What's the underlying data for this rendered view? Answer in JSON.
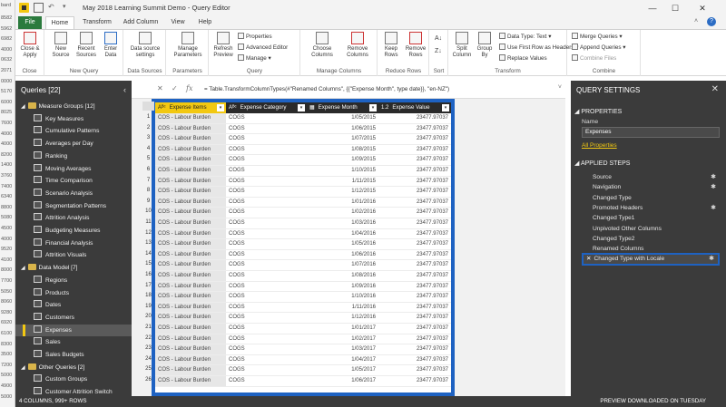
{
  "background_excel": {
    "fragment_text": "bard",
    "row_values": [
      "8582",
      "5962",
      "6982",
      "4000",
      "0632",
      "2071",
      "0000",
      "5170",
      "6000",
      "8025",
      "7600",
      "4000",
      "4000",
      "8200",
      "1400",
      "3760",
      "7400",
      "6340",
      "8800",
      "5080",
      "4500",
      "4000",
      "9520",
      "4100",
      "8000",
      "7700",
      "5050",
      "8060",
      "9280",
      "6920",
      "6100",
      "8300",
      "3500",
      "7200",
      "5000",
      "4900",
      "5000"
    ]
  },
  "window": {
    "title": "May 2018 Learning Summit Demo - Query Editor",
    "min_icon": "minimize-icon",
    "max_icon": "maximize-icon",
    "close_icon": "close-icon"
  },
  "ribbon_tabs": [
    "File",
    "Home",
    "Transform",
    "Add Column",
    "View",
    "Help"
  ],
  "ribbon": {
    "close": {
      "btn1": "Close &\nApply",
      "group": "Close"
    },
    "new_query": {
      "btn1": "New\nSource",
      "btn2": "Recent\nSources",
      "btn3": "Enter\nData",
      "group": "New Query"
    },
    "data_sources": {
      "btn1": "Data source\nsettings",
      "group": "Data Sources"
    },
    "parameters": {
      "btn1": "Manage\nParameters",
      "group": "Parameters"
    },
    "query": {
      "btn1": "Refresh\nPreview",
      "small1": "Properties",
      "small2": "Advanced Editor",
      "small3": "Manage",
      "group": "Query"
    },
    "manage_columns": {
      "btn1": "Choose\nColumns",
      "btn2": "Remove\nColumns",
      "group": "Manage Columns"
    },
    "reduce_rows": {
      "btn1": "Keep\nRows",
      "btn2": "Remove\nRows",
      "group": "Reduce Rows"
    },
    "sort": {
      "group": "Sort"
    },
    "transform": {
      "btn1": "Split\nColumn",
      "btn2": "Group\nBy",
      "small1": "Data Type: Text",
      "small2": "Use First Row as Headers",
      "small3": "Replace Values",
      "group": "Transform"
    },
    "combine": {
      "small1": "Merge Queries",
      "small2": "Append Queries",
      "small3": "Combine Files",
      "group": "Combine"
    }
  },
  "queries": {
    "title": "Queries [22]",
    "rows": [
      {
        "label": "Measure Groups [12]",
        "type": "group"
      },
      {
        "label": "Key Measures",
        "type": "item"
      },
      {
        "label": "Cumulative Patterns",
        "type": "item"
      },
      {
        "label": "Averages per Day",
        "type": "item"
      },
      {
        "label": "Ranking",
        "type": "item"
      },
      {
        "label": "Moving Averages",
        "type": "item"
      },
      {
        "label": "Time Comparison",
        "type": "item"
      },
      {
        "label": "Scenario Analysis",
        "type": "item"
      },
      {
        "label": "Segmentation Patterns",
        "type": "item"
      },
      {
        "label": "Attrition Analysis",
        "type": "item"
      },
      {
        "label": "Budgeting Measures",
        "type": "item"
      },
      {
        "label": "Financial Analysis",
        "type": "item"
      },
      {
        "label": "Attrition Visuals",
        "type": "item"
      },
      {
        "label": "Data Model [7]",
        "type": "group"
      },
      {
        "label": "Regions",
        "type": "item"
      },
      {
        "label": "Products",
        "type": "item"
      },
      {
        "label": "Dates",
        "type": "item"
      },
      {
        "label": "Customers",
        "type": "item"
      },
      {
        "label": "Expenses",
        "type": "item",
        "selected": true
      },
      {
        "label": "Sales",
        "type": "item"
      },
      {
        "label": "Sales Budgets",
        "type": "item"
      },
      {
        "label": "Other Queries [2]",
        "type": "group"
      },
      {
        "label": "Custom Groups",
        "type": "item"
      },
      {
        "label": "Customer Attrition Switch",
        "type": "item"
      }
    ]
  },
  "formula": {
    "text": "= Table.TransformColumnTypes(#\"Renamed Columns\", {{\"Expense Month\", type date}}, \"en-NZ\")"
  },
  "grid": {
    "columns": [
      {
        "type": "ABC",
        "label": "Expense Items"
      },
      {
        "type": "ABC",
        "label": "Expense Category"
      },
      {
        "type": "date",
        "label": "Expense Month"
      },
      {
        "type": "1.2",
        "label": "Expense Value"
      }
    ],
    "rows": [
      [
        "COS - Labour Burden",
        "COGS",
        "1/05/2015",
        "23477.97037"
      ],
      [
        "COS - Labour Burden",
        "COGS",
        "1/06/2015",
        "23477.97037"
      ],
      [
        "COS - Labour Burden",
        "COGS",
        "1/07/2015",
        "23477.97037"
      ],
      [
        "COS - Labour Burden",
        "COGS",
        "1/08/2015",
        "23477.97037"
      ],
      [
        "COS - Labour Burden",
        "COGS",
        "1/09/2015",
        "23477.97037"
      ],
      [
        "COS - Labour Burden",
        "COGS",
        "1/10/2015",
        "23477.97037"
      ],
      [
        "COS - Labour Burden",
        "COGS",
        "1/11/2015",
        "23477.97037"
      ],
      [
        "COS - Labour Burden",
        "COGS",
        "1/12/2015",
        "23477.97037"
      ],
      [
        "COS - Labour Burden",
        "COGS",
        "1/01/2016",
        "23477.97037"
      ],
      [
        "COS - Labour Burden",
        "COGS",
        "1/02/2016",
        "23477.97037"
      ],
      [
        "COS - Labour Burden",
        "COGS",
        "1/03/2016",
        "23477.97037"
      ],
      [
        "COS - Labour Burden",
        "COGS",
        "1/04/2016",
        "23477.97037"
      ],
      [
        "COS - Labour Burden",
        "COGS",
        "1/05/2016",
        "23477.97037"
      ],
      [
        "COS - Labour Burden",
        "COGS",
        "1/06/2016",
        "23477.97037"
      ],
      [
        "COS - Labour Burden",
        "COGS",
        "1/07/2016",
        "23477.97037"
      ],
      [
        "COS - Labour Burden",
        "COGS",
        "1/08/2016",
        "23477.97037"
      ],
      [
        "COS - Labour Burden",
        "COGS",
        "1/09/2016",
        "23477.97037"
      ],
      [
        "COS - Labour Burden",
        "COGS",
        "1/10/2016",
        "23477.97037"
      ],
      [
        "COS - Labour Burden",
        "COGS",
        "1/11/2016",
        "23477.97037"
      ],
      [
        "COS - Labour Burden",
        "COGS",
        "1/12/2016",
        "23477.97037"
      ],
      [
        "COS - Labour Burden",
        "COGS",
        "1/01/2017",
        "23477.97037"
      ],
      [
        "COS - Labour Burden",
        "COGS",
        "1/02/2017",
        "23477.97037"
      ],
      [
        "COS - Labour Burden",
        "COGS",
        "1/03/2017",
        "23477.97037"
      ],
      [
        "COS - Labour Burden",
        "COGS",
        "1/04/2017",
        "23477.97037"
      ],
      [
        "COS - Labour Burden",
        "COGS",
        "1/05/2017",
        "23477.97037"
      ],
      [
        "COS - Labour Burden",
        "COGS",
        "1/06/2017",
        "23477.97037"
      ]
    ]
  },
  "settings": {
    "title": "QUERY SETTINGS",
    "properties_title": "PROPERTIES",
    "name_label": "Name",
    "name_value": "Expenses",
    "all_properties": "All Properties",
    "applied_steps_title": "APPLIED STEPS",
    "steps": [
      {
        "label": "Source",
        "gear": true
      },
      {
        "label": "Navigation",
        "gear": true
      },
      {
        "label": "Changed Type",
        "gear": false
      },
      {
        "label": "Promoted Headers",
        "gear": true
      },
      {
        "label": "Changed Type1",
        "gear": false
      },
      {
        "label": "Unpivoted Other Columns",
        "gear": false
      },
      {
        "label": "Changed Type2",
        "gear": false
      },
      {
        "label": "Renamed Columns",
        "gear": false
      },
      {
        "label": "Changed Type with Locale",
        "gear": true,
        "selected": true
      }
    ]
  },
  "status": {
    "left": "4 COLUMNS, 999+ ROWS",
    "right": "PREVIEW DOWNLOADED ON TUESDAY"
  },
  "colors": {
    "accent_yellow": "#f2c811",
    "highlight_blue": "#1e62c2",
    "file_tab_green": "#2b7a3d",
    "pane_dark": "#3b3b3b"
  }
}
